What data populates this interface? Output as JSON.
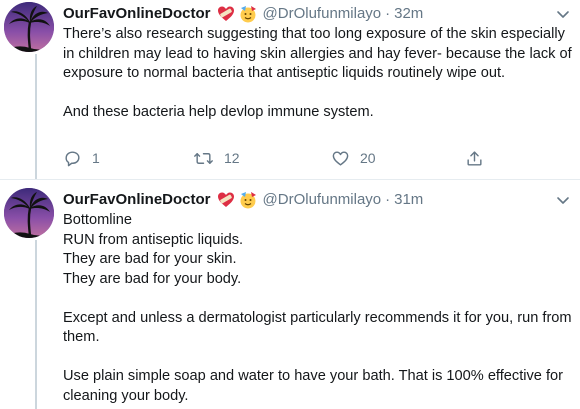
{
  "tweets": [
    {
      "display_name": "OurFavOnlineDoctor",
      "badges": [
        "heart-with-bandage-emoji",
        "partying-face-emoji"
      ],
      "handle": "@DrOlufunmilayo",
      "separator": "·",
      "time": "32m",
      "paragraphs": [
        "There’s also research suggesting that too long exposure of the skin especially in children may lead to having skin allergies and hay fever- because the lack of exposure to normal bacteria that antiseptic liquids routinely wipe out.",
        "And these bacteria help devlop immune system."
      ],
      "actions": {
        "reply_count": "1",
        "retweet_count": "12",
        "like_count": "20"
      }
    },
    {
      "display_name": "OurFavOnlineDoctor",
      "badges": [
        "heart-with-bandage-emoji",
        "partying-face-emoji"
      ],
      "handle": "@DrOlufunmilayo",
      "separator": "·",
      "time": "31m",
      "paragraphs": [
        "Bottomline\nRUN from antiseptic liquids.\nThey are bad for your skin.\nThey are bad for your body.",
        "Except and unless a dermatologist particularly recommends it for you, run from them.",
        "Use plain simple soap and water to have your bath. That is 100% effective for cleaning your body."
      ]
    }
  ],
  "colors": {
    "text": "#14171a",
    "secondary": "#657786",
    "thread_line": "#ccd6dd",
    "divider": "#e6ecf0",
    "avatar_bg": "#5b3c8f"
  }
}
